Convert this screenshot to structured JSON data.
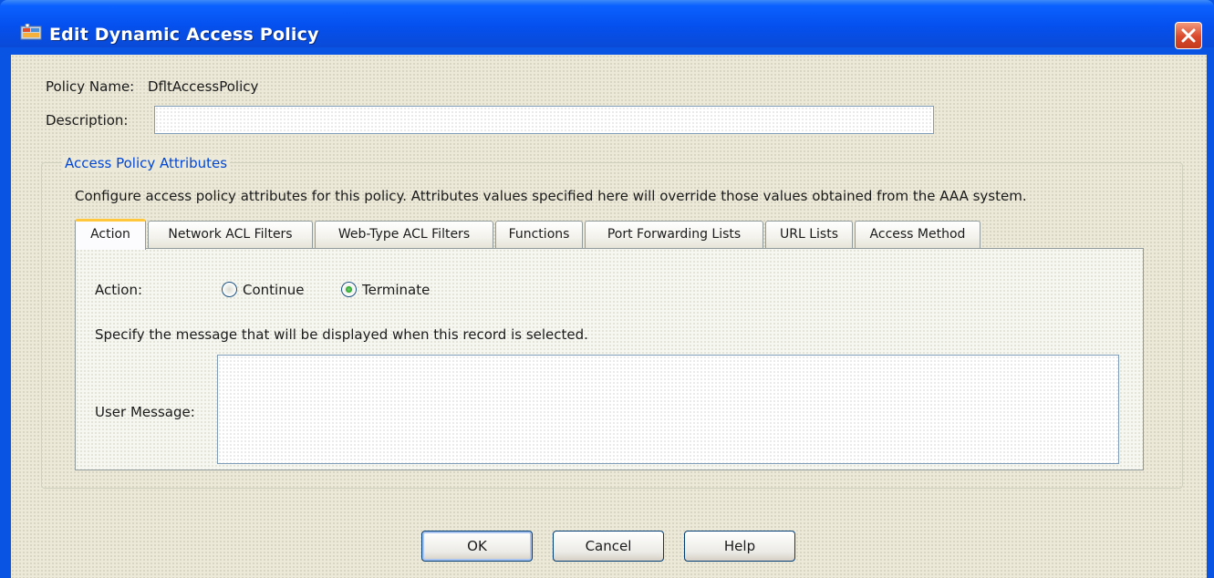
{
  "window": {
    "title": "Edit Dynamic Access Policy",
    "accent_color": "#0a54e4",
    "icon": "app-icon"
  },
  "form": {
    "policy_name_label": "Policy Name:",
    "policy_name_value": "DfltAccessPolicy",
    "description_label": "Description:",
    "description_value": ""
  },
  "group": {
    "title": "Access Policy Attributes",
    "instructions": "Configure access policy attributes for this policy. Attributes values specified here will override those values obtained from the AAA system."
  },
  "tabs": [
    {
      "label": "Action",
      "active": true
    },
    {
      "label": "Network ACL Filters",
      "active": false
    },
    {
      "label": "Web-Type ACL Filters",
      "active": false
    },
    {
      "label": "Functions",
      "active": false
    },
    {
      "label": "Port Forwarding Lists",
      "active": false
    },
    {
      "label": "URL Lists",
      "active": false
    },
    {
      "label": "Access Method",
      "active": false
    }
  ],
  "action_tab": {
    "action_label": "Action:",
    "options": [
      {
        "label": "Continue",
        "selected": false
      },
      {
        "label": "Terminate",
        "selected": true
      }
    ],
    "message_hint": "Specify the message that will be displayed when this record is selected.",
    "user_message_label": "User Message:",
    "user_message_value": ""
  },
  "buttons": {
    "ok": "OK",
    "cancel": "Cancel",
    "help": "Help"
  }
}
